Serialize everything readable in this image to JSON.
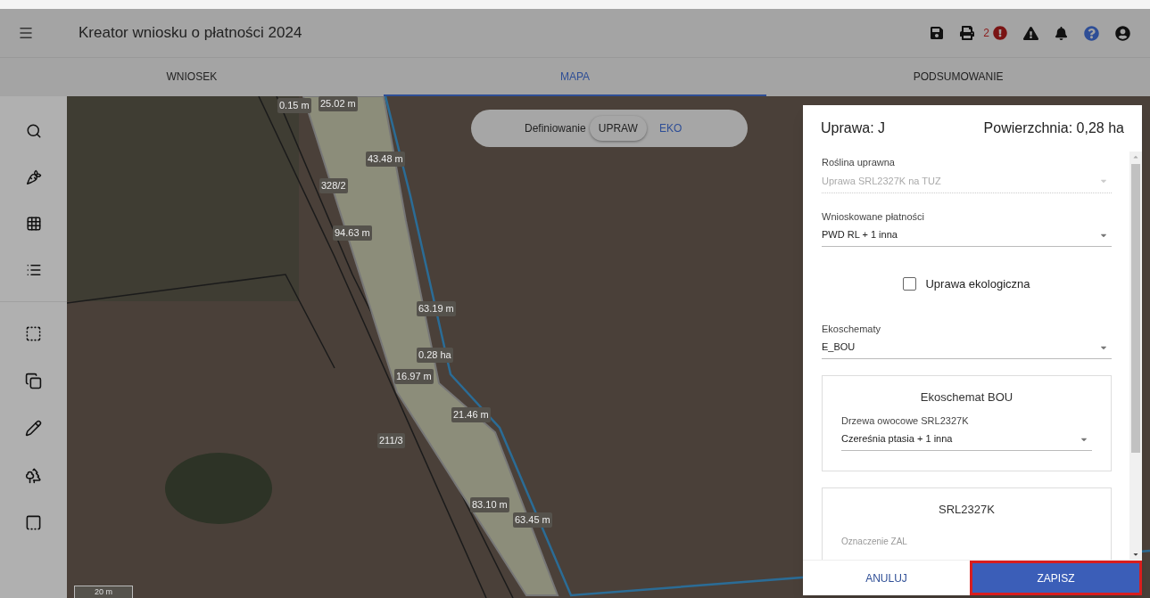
{
  "app_bar": {
    "title": "Kreator wniosku o płatności 2024",
    "error_count": "2"
  },
  "tabs": [
    {
      "label": "WNIOSEK",
      "selected": false
    },
    {
      "label": "MAPA",
      "selected": true
    },
    {
      "label": "PODSUMOWANIE",
      "selected": false
    }
  ],
  "mode_switch": {
    "label": "Definiowanie",
    "options": [
      {
        "label": "UPRAW",
        "selected": true
      },
      {
        "label": "EKO",
        "selected": false
      }
    ]
  },
  "map_labels": [
    "0.15 m",
    "25.02 m",
    "43.48 m",
    "328/2",
    "94.63 m",
    "63.19 m",
    "0.28 ha",
    "16.97 m",
    "21.46 m",
    "211/3",
    "83.10 m",
    "63.45 m"
  ],
  "scale": "20 m",
  "dialog": {
    "title": "Uprawa: J",
    "area": "Powierzchnia: 0,28 ha",
    "fields": [
      {
        "label": "Roślina uprawna",
        "value": "Uprawa SRL2327K na TUZ",
        "disabled": true
      },
      {
        "label": "Wnioskowane płatności",
        "value": "PWD RL + 1 inna",
        "disabled": false
      }
    ],
    "checkbox": {
      "label": "Uprawa ekologiczna",
      "checked": false
    },
    "eco_field": {
      "label": "Ekoschematy",
      "value": "E_BOU",
      "disabled": false
    },
    "sections": [
      {
        "title": "Ekoschemat BOU",
        "field": {
          "label": "Drzewa owocowe SRL2327K",
          "value": "Czereśnia ptasia + 1 inna"
        }
      },
      {
        "title": "SRL2327K",
        "field": {
          "label": "Oznaczenie ZAL"
        }
      }
    ],
    "cancel": "ANULUJ",
    "save": "ZAPISZ"
  }
}
